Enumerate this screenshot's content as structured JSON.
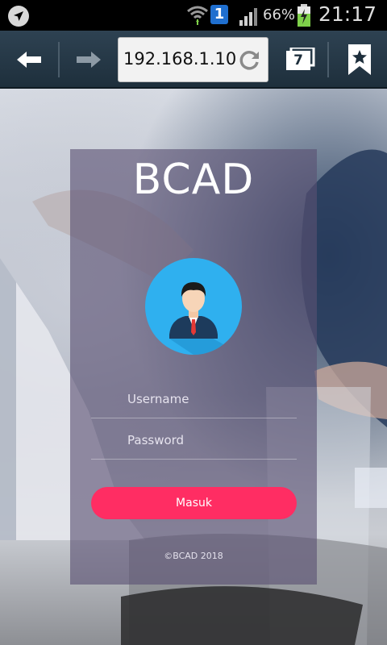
{
  "status_bar": {
    "notification_count": "1",
    "battery_percent": "66%",
    "time": "21:17"
  },
  "browser": {
    "url": "192.168.1.10",
    "tab_count": "7"
  },
  "login": {
    "brand": "BCAD",
    "username_placeholder": "Username",
    "password_placeholder": "Password",
    "submit_label": "Masuk",
    "footer": "©BCAD 2018",
    "button_color": "#ff2d63",
    "avatar_color": "#2fb0ef"
  }
}
